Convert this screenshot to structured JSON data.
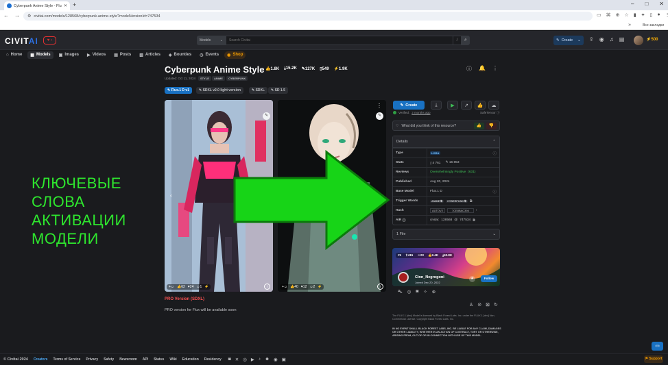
{
  "browser": {
    "tab_title": "Cyberpunk Anime Style - Flux.1 D...",
    "url": "civitai.com/models/128568/cyberpunk-anime-style?modelVersionId=747534",
    "bookmarks_label": "Все закладки"
  },
  "header": {
    "logo_main": "CIVIT",
    "logo_ai": "AI",
    "search_select": "Models",
    "search_placeholder": "Search Civitai",
    "search_shortcut": "/",
    "create_label": "Create",
    "buzz_count": "500"
  },
  "nav": [
    {
      "label": "Home",
      "icon": "⌂"
    },
    {
      "label": "Models",
      "icon": "▦"
    },
    {
      "label": "Images",
      "icon": "▣"
    },
    {
      "label": "Videos",
      "icon": "▶"
    },
    {
      "label": "Posts",
      "icon": "▤"
    },
    {
      "label": "Articles",
      "icon": "▧"
    },
    {
      "label": "Bounties",
      "icon": "◈"
    },
    {
      "label": "Events",
      "icon": "◷"
    },
    {
      "label": "Shop",
      "icon": "◉"
    }
  ],
  "model": {
    "title": "Cyberpunk Anime Style",
    "stats": {
      "likes": "1.8K",
      "downloads": "15.2K",
      "generations": "127K",
      "collections": "549",
      "buzz": "1.9K"
    },
    "updated": "Updated: Oct 11, 2024",
    "tags": [
      "STYLE",
      "ANIME",
      "CYBERPUNK"
    ],
    "versions": [
      "Flux.1 D v1",
      "SDXL v2.0 light version",
      "SDXL",
      "SD 1.5"
    ]
  },
  "images": [
    {
      "reactions": {
        "likes": "62",
        "hearts": "24",
        "laughs": "1",
        "cries": "1"
      }
    },
    {
      "reactions": {
        "likes": "40",
        "hearts": "12",
        "laughs": "2",
        "cries": "1"
      }
    }
  ],
  "description": {
    "pro_heading": "PRO Version (SDXL)",
    "pro_text": "PRO version for Flux will be available soon"
  },
  "overlay": {
    "lines": [
      "КЛЮЧЕВЫЕ",
      "СЛОВА",
      "АКТИВАЦИИ",
      "МОДЕЛИ"
    ]
  },
  "panel": {
    "create_label": "Create",
    "verified": "Verified:",
    "verified_when": "2 months ago",
    "safetensor": "SafeTensor",
    "feedback_q": "What did you think of this resource?",
    "details_title": "Details",
    "rows": {
      "type_label": "Type",
      "type_value": "LORA",
      "stats_label": "Stats",
      "stats_downloads": "4 761",
      "stats_generations": "16 853",
      "reviews_label": "Reviews",
      "reviews_value": "Overwhelmingly Positive",
      "reviews_count": "(631)",
      "published_label": "Published",
      "published_value": "Aug 20, 2024",
      "base_label": "Base Model",
      "base_value": "Flux.1 D",
      "trigger_label": "Trigger Words",
      "trigger_1": "ANIME",
      "trigger_2": "CYBERPUNK",
      "hash_label": "Hash",
      "hash_type": "AUTOV2",
      "hash_value": "7CE8BAC394",
      "air_label": "AIR",
      "air_prefix": "civitai:",
      "air_model": "128568",
      "air_version": "747534"
    },
    "files_label": "1 File",
    "creator": {
      "stats": [
        "#5",
        "415",
        "23",
        "2.4K",
        "43.8K"
      ],
      "name": "Cinn_Negrogoni",
      "joined": "Joined Dec 20, 2022",
      "follow": "Follow"
    },
    "license_1": "The FLUX.1 [dev] Model is licensed by Black Forest Labs. Inc. under the FLUX.1 [dev] Non-Commercial License. Copyright Black Forest Labs. Inc.",
    "license_2": "IN NO EVENT SHALL BLACK FOREST LABS, INC. BE LIABLE FOR ANY CLAIM, DAMAGES OR OTHER LIABILITY, WHETHER IN AN ACTION OF CONTRACT, TORT OR OTHERWISE, ARISING FROM, OUT OF OR IN CONNECTION WITH USE OF THIS MODEL."
  },
  "footer": {
    "copyright": "© Civitai 2024",
    "links": [
      "Creators",
      "Terms of Service",
      "Privacy",
      "Safety",
      "Newsroom",
      "API",
      "Status",
      "Wiki",
      "Education",
      "Residency"
    ],
    "support": "Support"
  },
  "colors": {
    "accent": "#1971c2",
    "overlay_green": "#2ee62e",
    "arrow_green": "#17d417",
    "danger": "#fa5252"
  }
}
